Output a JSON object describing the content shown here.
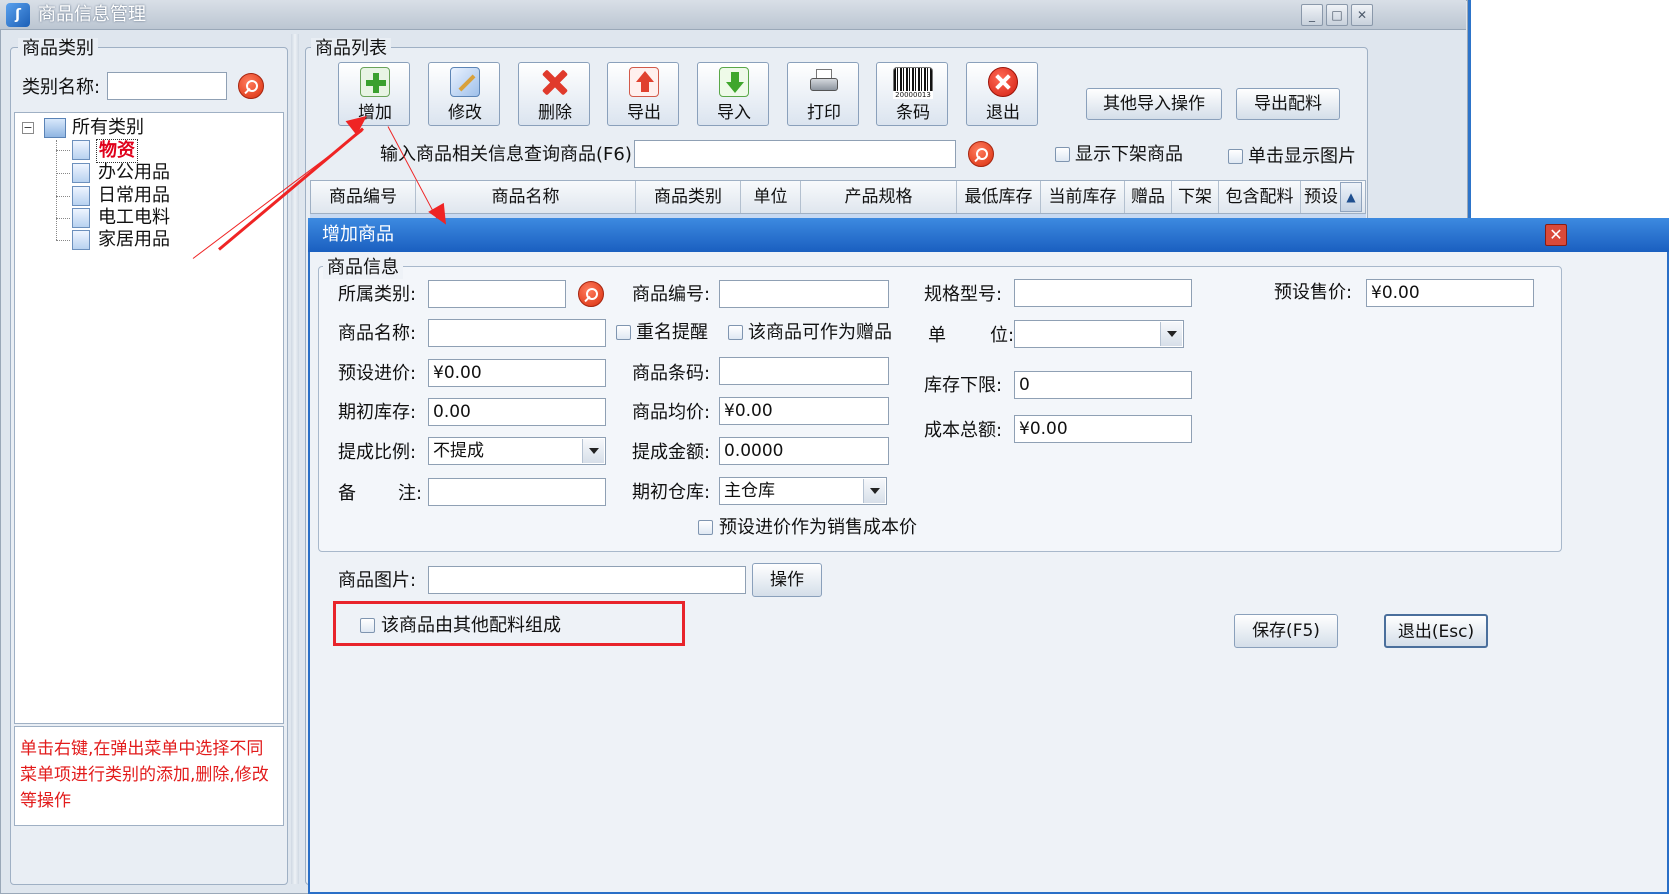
{
  "window": {
    "title": "商品信息管理",
    "minimize": "_",
    "maximize": "□",
    "close": "✕"
  },
  "left_panel": {
    "group_title": "商品类别",
    "category_name_label": "类别名称:",
    "category_name_value": "",
    "tree": {
      "expander": "−",
      "root": "所有类别",
      "children": [
        "物资",
        "办公用品",
        "日常用品",
        "电工电料",
        "家居用品"
      ]
    },
    "tip": "单击右键,在弹出菜单中选择不同菜单项进行类别的添加,删除,修改等操作"
  },
  "right_panel": {
    "group_title": "商品列表",
    "toolbar": [
      "增加",
      "修改",
      "删除",
      "导出",
      "导入",
      "打印",
      "条码",
      "退出"
    ],
    "other_import_label": "其他导入操作",
    "export_parts_label": "导出配料",
    "search_label": "输入商品相关信息查询商品(F6):",
    "search_value": "",
    "show_offshelf_label": "显示下架商品",
    "click_show_image_label": "单击显示图片",
    "barcode_caption": "20000013",
    "grid_headers": [
      "商品编号",
      "商品名称",
      "商品类别",
      "单位",
      "产品规格",
      "最低库存",
      "当前库存",
      "赠品",
      "下架",
      "包含配料",
      "预设"
    ],
    "scroll_up": "▲"
  },
  "dialog": {
    "title": "增加商品",
    "close": "✕",
    "info_group_title": "商品信息",
    "fields": {
      "category_label": "所属类别:",
      "category_value": "",
      "code_label": "商品编号:",
      "code_value": "",
      "spec_label": "规格型号:",
      "spec_value": "",
      "preset_sale_label": "预设售价:",
      "preset_sale_value": "¥0.00",
      "name_label": "商品名称:",
      "name_value": "",
      "dup_reminder_label": "重名提醒",
      "gift_label": "该商品可作为赠品",
      "unit_label_a": "单",
      "unit_label_b": "位:",
      "unit_value": "",
      "preset_purchase_label": "预设进价:",
      "preset_purchase_value": "¥0.00",
      "barcode_label": "商品条码:",
      "barcode_value": "",
      "min_stock_label": "库存下限:",
      "min_stock_value": "0",
      "initial_stock_label": "期初库存:",
      "initial_stock_value": "0.00",
      "avg_price_label": "商品均价:",
      "avg_price_value": "¥0.00",
      "total_cost_label": "成本总额:",
      "total_cost_value": "¥0.00",
      "commission_ratio_label": "提成比例:",
      "commission_ratio_value": "不提成",
      "commission_amount_label": "提成金额:",
      "commission_amount_value": "0.0000",
      "remark_label_a": "备",
      "remark_label_b": "注:",
      "remark_value": "",
      "initial_warehouse_label": "期初仓库:",
      "initial_warehouse_value": "主仓库",
      "purchase_as_cost_label": "预设进价作为销售成本价"
    },
    "image_label": "商品图片:",
    "image_value": "",
    "operate_label": "操作",
    "composed_label": "该商品由其他配料组成",
    "save_label": "保存(F5)",
    "exit_label": "退出(Esc)"
  },
  "colors": {
    "accent": "#1a5fc0",
    "highlight": "#e8242b",
    "tip_text": "#e21b1b"
  }
}
